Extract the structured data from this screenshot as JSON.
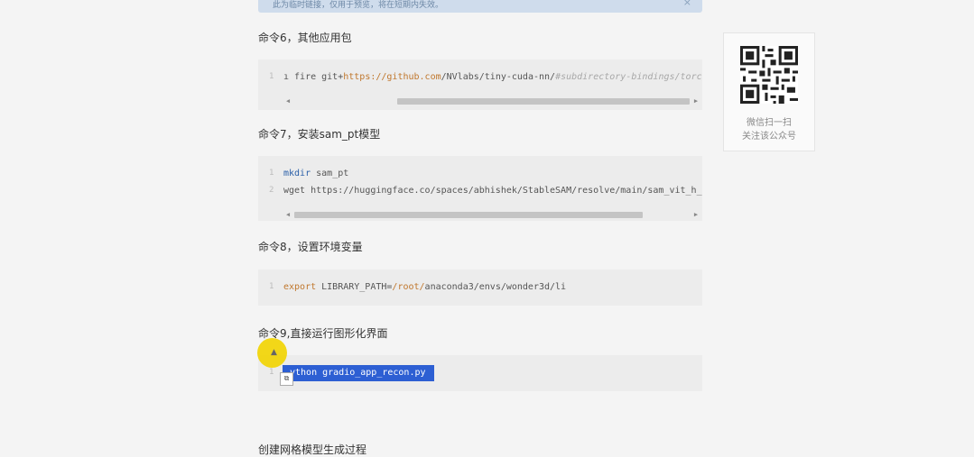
{
  "banner": {
    "text": "此为临时链接，仅用于预览，将在短期内失效。",
    "close": "×"
  },
  "sections": {
    "cmd6": {
      "title": "命令6，其他应用包"
    },
    "cmd7": {
      "title": "命令7，安装sam_pt模型"
    },
    "cmd8": {
      "title": "命令8，设置环境变量"
    },
    "cmd9": {
      "title": "命令9,直接运行图形化界面"
    },
    "next": {
      "title": "创建网格模型生成过程"
    }
  },
  "code6": {
    "line_number": "1",
    "pre": "ı fire git+",
    "url1": "https://",
    "domain": "github.com",
    "mid": "/NVlabs/tiny-cuda-nn/",
    "comment": "#subdirectory-bindings/torch"
  },
  "code7": {
    "l1_num": "1",
    "l1_kw": "mkdir",
    "l1_rest": " sam_pt",
    "l2_num": "2",
    "l2_kw": "wget",
    "l2_rest": "  https://huggingface.co/spaces/abhishek/StableSAM/resolve/main/sam_vit_h_"
  },
  "code8": {
    "line_number": "1",
    "kw": "export",
    "var": " LIBRARY_PATH=",
    "root": "/root/",
    "rest": "anaconda3/envs/wonder3d/li"
  },
  "code9": {
    "line_number": "1",
    "text": "ython gradio_app_recon.py"
  },
  "scroll": {
    "left": "◀",
    "right": "▶"
  },
  "qr": {
    "line1": "微信扫一扫",
    "line2": "关注该公众号"
  },
  "colors": {
    "selection": "#2d5fd3",
    "cursor": "#f2d400",
    "banner": "#cfdcec"
  },
  "icons": {
    "cursor": "mouse-pointer-icon",
    "copy": "copy-icon",
    "close": "close-icon"
  }
}
